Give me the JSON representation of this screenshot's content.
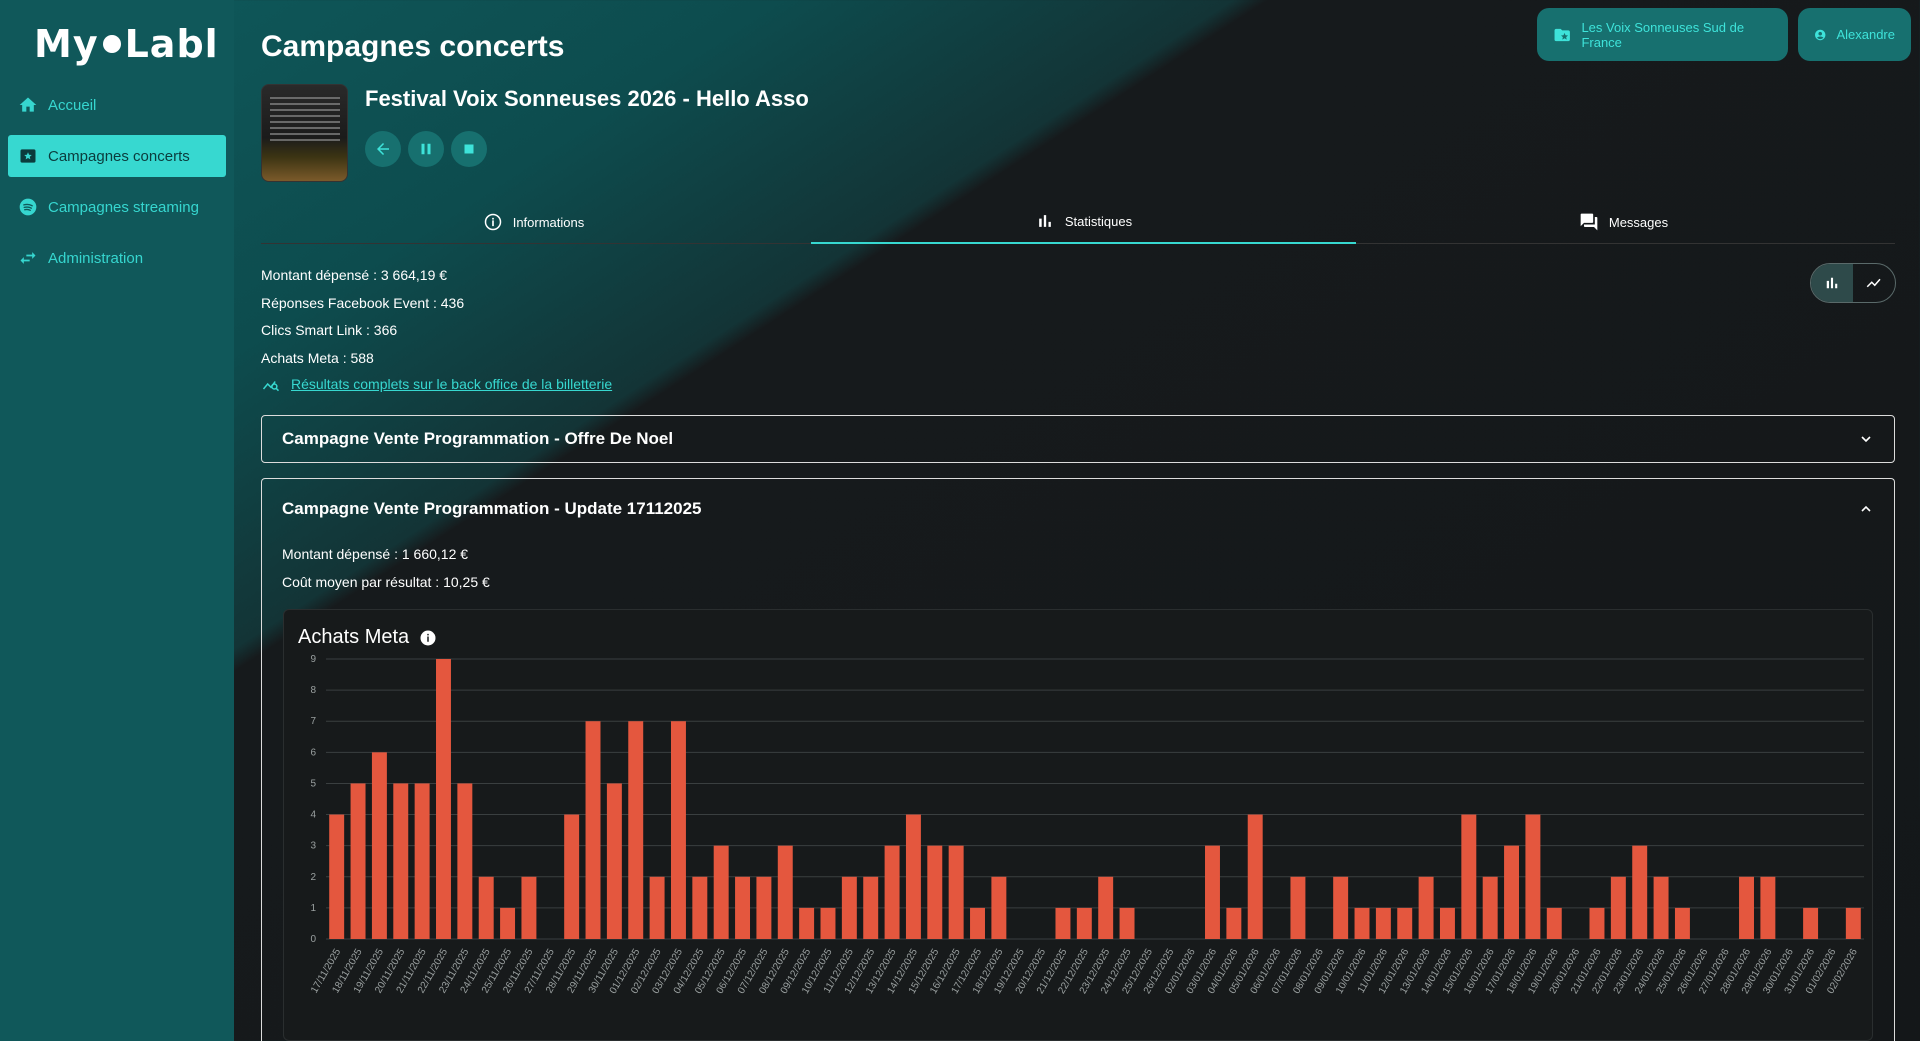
{
  "app": {
    "logo": "My Labl"
  },
  "sidebar": {
    "items": [
      {
        "label": "Accueil",
        "icon": "home-icon",
        "active": false
      },
      {
        "label": "Campagnes concerts",
        "icon": "star-box-icon",
        "active": true
      },
      {
        "label": "Campagnes streaming",
        "icon": "spotify-icon",
        "active": false
      },
      {
        "label": "Administration",
        "icon": "swap-arrows-icon",
        "active": false
      }
    ]
  },
  "header": {
    "org_button": "Les Voix Sonneuses Sud de France",
    "user_button": "Alexandre",
    "page_title": "Campagnes concerts",
    "campaign_name": "Festival Voix Sonneuses 2026 - Hello Asso"
  },
  "tabs": [
    {
      "label": "Informations",
      "icon": "info-icon",
      "active": false
    },
    {
      "label": "Statistiques",
      "icon": "bar-chart-icon",
      "active": true
    },
    {
      "label": "Messages",
      "icon": "messages-icon",
      "active": false
    }
  ],
  "stats": {
    "spent": "Montant dépensé : 3 664,19 €",
    "facebook": "Réponses Facebook Event : 436",
    "smartlink": "Clics Smart Link : 366",
    "meta": "Achats Meta : 588",
    "link": "Résultats complets sur le back office de la billetterie"
  },
  "panels": {
    "p1": {
      "title": "Campagne Vente Programmation - Offre De Noel"
    },
    "p2": {
      "title": "Campagne Vente Programmation - Update 17112025",
      "spent": "Montant dépensé : 1 660,12 €",
      "cost": "Coût moyen par résultat : 10,25 €"
    }
  },
  "colors": {
    "accent": "#37d8d0",
    "bar": "#e4573e"
  },
  "chart_data": {
    "type": "bar",
    "title": "Achats Meta",
    "ylim": [
      0,
      9
    ],
    "yticks": [
      0,
      1,
      2,
      3,
      4,
      5,
      6,
      7,
      8,
      9
    ],
    "grid": true,
    "categories": [
      "17/11/2025",
      "18/11/2025",
      "19/11/2025",
      "20/11/2025",
      "21/11/2025",
      "22/11/2025",
      "23/11/2025",
      "24/11/2025",
      "25/11/2025",
      "26/11/2025",
      "27/11/2025",
      "28/11/2025",
      "29/11/2025",
      "30/11/2025",
      "01/12/2025",
      "02/12/2025",
      "03/12/2025",
      "04/12/2025",
      "05/12/2025",
      "06/12/2025",
      "07/12/2025",
      "08/12/2025",
      "09/12/2025",
      "10/12/2025",
      "11/12/2025",
      "12/12/2025",
      "13/12/2025",
      "14/12/2025",
      "15/12/2025",
      "16/12/2025",
      "17/12/2025",
      "18/12/2025",
      "19/12/2025",
      "20/12/2025",
      "21/12/2025",
      "22/12/2025",
      "23/12/2025",
      "24/12/2025",
      "25/12/2025",
      "26/12/2025",
      "02/01/2026",
      "03/01/2026",
      "04/01/2026",
      "05/01/2026",
      "06/01/2026",
      "07/01/2026",
      "08/01/2026",
      "09/01/2026",
      "10/01/2026",
      "11/01/2026",
      "12/01/2026",
      "13/01/2026",
      "14/01/2026",
      "15/01/2026",
      "16/01/2026",
      "17/01/2026",
      "18/01/2026",
      "19/01/2026",
      "20/01/2026",
      "21/01/2026",
      "22/01/2026",
      "23/01/2026",
      "24/01/2026",
      "25/01/2026",
      "26/01/2026",
      "27/01/2026",
      "28/01/2026",
      "29/01/2026",
      "30/01/2026",
      "31/01/2026",
      "01/02/2026",
      "02/02/2026"
    ],
    "values": [
      4,
      5,
      6,
      5,
      5,
      9,
      5,
      2,
      1,
      2,
      0,
      4,
      7,
      5,
      7,
      2,
      7,
      2,
      3,
      2,
      2,
      3,
      1,
      1,
      2,
      2,
      3,
      4,
      3,
      3,
      1,
      2,
      0,
      0,
      1,
      1,
      2,
      1,
      0,
      0,
      0,
      3,
      1,
      4,
      0,
      2,
      0,
      2,
      1,
      1,
      1,
      2,
      1,
      4,
      2,
      3,
      4,
      1,
      0,
      1,
      2,
      3,
      2,
      1,
      0,
      0,
      2,
      2,
      0,
      1,
      0,
      1
    ]
  }
}
